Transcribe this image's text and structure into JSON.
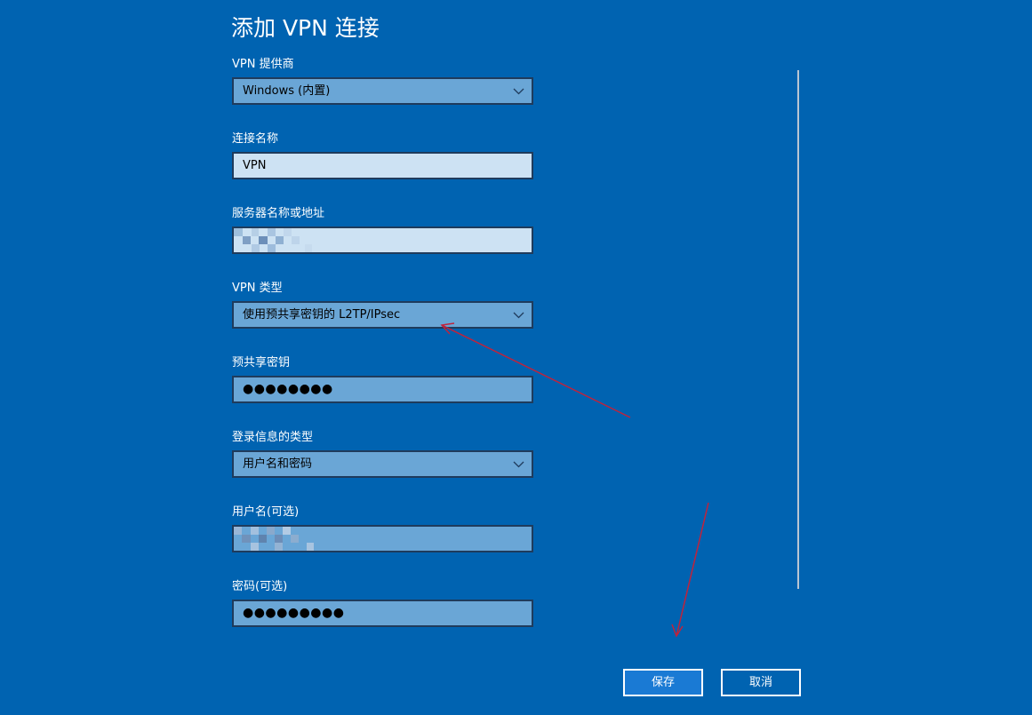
{
  "window": {
    "title": "添加 VPN 连接"
  },
  "form": {
    "provider": {
      "label": "VPN 提供商",
      "value": "Windows (内置)"
    },
    "connection_name": {
      "label": "连接名称",
      "value": "VPN"
    },
    "server": {
      "label": "服务器名称或地址",
      "value": ""
    },
    "vpn_type": {
      "label": "VPN 类型",
      "value": "使用预共享密钥的 L2TP/IPsec"
    },
    "preshared_key": {
      "label": "预共享密钥",
      "value": "●●●●●●●●"
    },
    "signin_type": {
      "label": "登录信息的类型",
      "value": "用户名和密码"
    },
    "username": {
      "label": "用户名(可选)",
      "value": ""
    },
    "password": {
      "label": "密码(可选)",
      "value": "●●●●●●●●●"
    }
  },
  "buttons": {
    "save": "保存",
    "cancel": "取消"
  },
  "colors": {
    "background": "#0063b1",
    "field_mid": "#6aa6d6",
    "field_light": "#cde2f3",
    "annotation_arrow": "#c0233c"
  }
}
